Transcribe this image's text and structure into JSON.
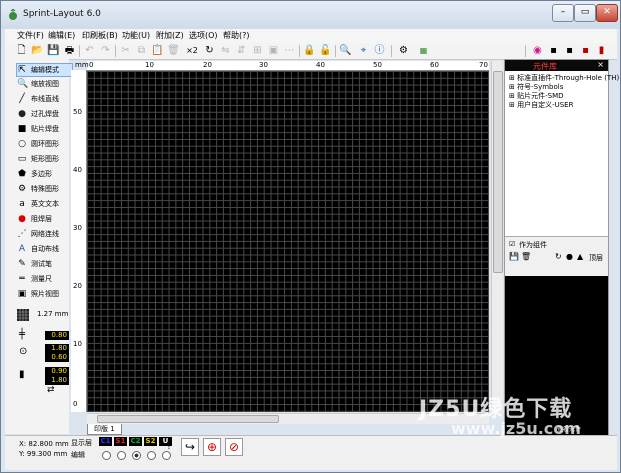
{
  "window": {
    "title": "Sprint-Layout 6.0",
    "buttons": {
      "minimize": "–",
      "maximize": "▭",
      "close": "✕"
    }
  },
  "menu": [
    "文件(F)",
    "编辑(E)",
    "印刷板(B)",
    "功能(U)",
    "附加(Z)",
    "选项(O)",
    "帮助(?)"
  ],
  "toolbar": {
    "zoom_label": "×2"
  },
  "tools": [
    {
      "label": "编辑模式",
      "icon": "cursor-icon"
    },
    {
      "label": "缩放视图",
      "icon": "magnifier-icon"
    },
    {
      "label": "布线直线",
      "icon": "line-icon"
    },
    {
      "label": "过孔焊盘",
      "icon": "via-pad-icon"
    },
    {
      "label": "贴片焊盘",
      "icon": "smd-pad-icon"
    },
    {
      "label": "圆环图形",
      "icon": "circle-icon"
    },
    {
      "label": "矩形图形",
      "icon": "rectangle-icon"
    },
    {
      "label": "多边形",
      "icon": "polygon-icon"
    },
    {
      "label": "特殊图形",
      "icon": "special-shape-icon"
    },
    {
      "label": "英文文本",
      "icon": "text-icon"
    },
    {
      "label": "阻焊层",
      "icon": "solder-mask-icon"
    },
    {
      "label": "网络连线",
      "icon": "connection-icon"
    },
    {
      "label": "自动布线",
      "icon": "autoroute-icon"
    },
    {
      "label": "测试笔",
      "icon": "test-pen-icon"
    },
    {
      "label": "测量尺",
      "icon": "ruler-icon"
    },
    {
      "label": "照片视图",
      "icon": "photo-view-icon"
    }
  ],
  "grid": {
    "value": "1.27 mm"
  },
  "params": {
    "track_width": "0.80",
    "pad_outer": "1.80",
    "pad_inner": "0.60",
    "smd_w": "0.90",
    "smd_h": "1.80"
  },
  "ruler": {
    "unit": "mm",
    "top_ticks": [
      "0",
      "10",
      "20",
      "30",
      "40",
      "50",
      "60",
      "70"
    ],
    "left_ticks": [
      "0",
      "10",
      "20",
      "30",
      "40",
      "50"
    ]
  },
  "board_tab": "印版 1",
  "library": {
    "title": "元件库",
    "close": "×",
    "tree": [
      "标准直插件-Through-Hole (TH)",
      "符号-Symbols",
      "贴片元件-SMD",
      "用户自定义-USER"
    ],
    "as_group": "作为组件",
    "top_label": "顶层",
    "preview_label": "查看元件"
  },
  "status": {
    "x": "X:  82.800 mm",
    "y": "Y:  99.300 mm",
    "show_layer": "显示层",
    "edit": "编辑",
    "layers": [
      {
        "name": "C1",
        "color": "#1a3dff"
      },
      {
        "name": "S1",
        "color": "#e8241b"
      },
      {
        "name": "C2",
        "color": "#12a82d"
      },
      {
        "name": "S2",
        "color": "#e0d000"
      },
      {
        "name": "U",
        "color": "#ffffff"
      }
    ],
    "help": "?"
  },
  "watermark": {
    "line1": "JZ5U绿色下载",
    "line2": "www.jz5u.com"
  }
}
